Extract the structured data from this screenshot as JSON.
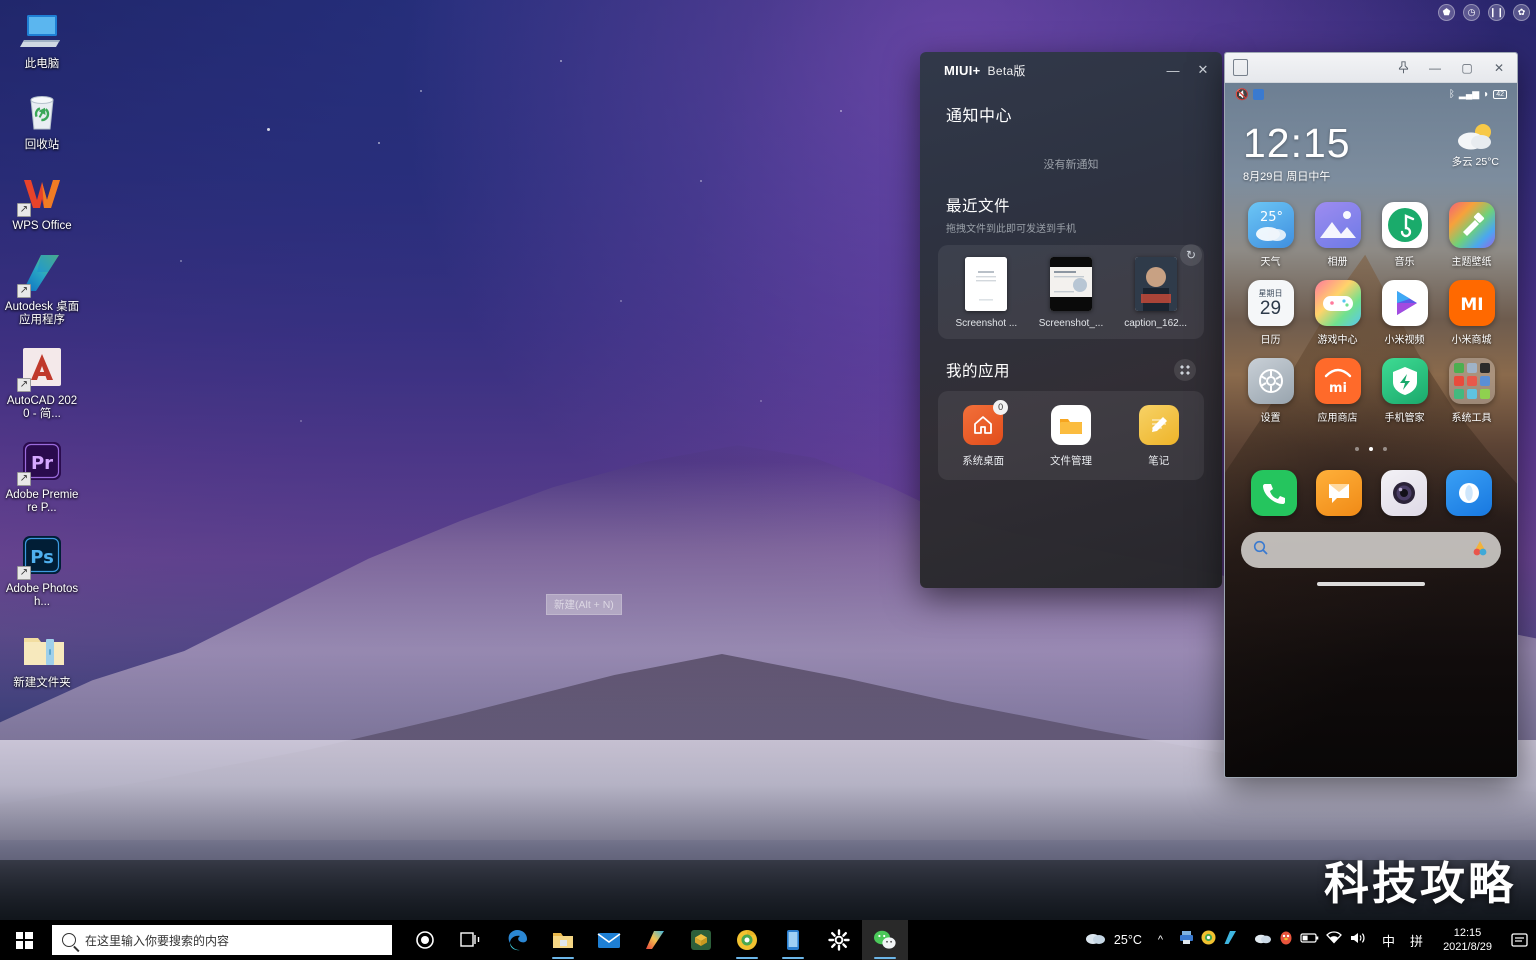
{
  "desktop": {
    "icons": [
      {
        "label": "此电脑",
        "icon": "computer-icon",
        "shortcut": false
      },
      {
        "label": "回收站",
        "icon": "recycle-bin-icon",
        "shortcut": false
      },
      {
        "label": "WPS Office",
        "icon": "wps-office-icon",
        "shortcut": true
      },
      {
        "label": "Autodesk 桌面应用程序",
        "icon": "autodesk-icon",
        "shortcut": true
      },
      {
        "label": "AutoCAD 2020 - 简...",
        "icon": "autocad-icon",
        "shortcut": true
      },
      {
        "label": "Adobe Premiere P...",
        "icon": "premiere-pro-icon",
        "shortcut": true
      },
      {
        "label": "Adobe Photosh...",
        "icon": "photoshop-icon",
        "shortcut": true
      },
      {
        "label": "新建文件夹",
        "icon": "folder-icon",
        "shortcut": false
      }
    ],
    "tooltip": "新建(Alt + N)",
    "watermark": "科技攻略",
    "floaters": [
      "record-icon",
      "clock-icon",
      "pause-icon",
      "settings-icon"
    ]
  },
  "miui": {
    "brand": "MIUI+",
    "beta": "Beta版",
    "minimize_label": "—",
    "close_label": "✕",
    "notification": {
      "title": "通知中心",
      "empty_text": "没有新通知"
    },
    "recent_files": {
      "title": "最近文件",
      "subtitle": "拖拽文件到此即可发送到手机",
      "refresh_icon": "refresh-icon",
      "items": [
        {
          "name": "Screenshot ...",
          "thumb": "document-thumb"
        },
        {
          "name": "Screenshot_...",
          "thumb": "article-thumb"
        },
        {
          "name": "caption_162...",
          "thumb": "portrait-thumb"
        }
      ]
    },
    "my_apps": {
      "title": "我的应用",
      "grid_icon": "grid-icon",
      "items": [
        {
          "name": "系统桌面",
          "icon": "home-icon",
          "badge": "0",
          "color": "#ef5a2a"
        },
        {
          "name": "文件管理",
          "icon": "folder-icon",
          "badge": "",
          "color": "#f5a623"
        },
        {
          "name": "笔记",
          "icon": "note-pencil-icon",
          "badge": "",
          "color": "#f3c34a"
        }
      ]
    }
  },
  "phone": {
    "titlebar": {
      "doc_icon": "new-page-icon",
      "pin_label": "pin-icon",
      "minimize_label": "—",
      "maximize_label": "▢",
      "close_label": "✕"
    },
    "statusbar": {
      "left_icons": [
        "mute-icon",
        "app-icon"
      ],
      "right_icons": [
        "bluetooth-icon",
        "signal-icon",
        "wifi-icon"
      ],
      "battery": "42"
    },
    "clock": "12:15",
    "date": "8月29日 周日中午",
    "weather": {
      "condition": "多云",
      "temp": "25°C",
      "icon": "partly-cloudy-icon"
    },
    "apps": [
      {
        "name": "天气",
        "icon": "weather-widget-icon",
        "value": "25°"
      },
      {
        "name": "相册",
        "icon": "gallery-icon",
        "value": ""
      },
      {
        "name": "音乐",
        "icon": "music-icon",
        "value": ""
      },
      {
        "name": "主题壁纸",
        "icon": "themes-icon",
        "value": ""
      },
      {
        "name": "日历",
        "icon": "calendar-icon",
        "value": "29"
      },
      {
        "name": "游戏中心",
        "icon": "game-center-icon",
        "value": ""
      },
      {
        "name": "小米视频",
        "icon": "mi-video-icon",
        "value": ""
      },
      {
        "name": "小米商城",
        "icon": "mi-store-icon",
        "value": ""
      },
      {
        "name": "设置",
        "icon": "settings-gear-icon",
        "value": ""
      },
      {
        "name": "应用商店",
        "icon": "app-store-icon",
        "value": ""
      },
      {
        "name": "手机管家",
        "icon": "security-shield-icon",
        "value": ""
      },
      {
        "name": "系统工具",
        "icon": "system-tools-folder-icon",
        "value": ""
      }
    ],
    "calendar_weekday": "星期日",
    "dock": [
      {
        "name": "电话",
        "icon": "phone-icon"
      },
      {
        "name": "短信",
        "icon": "message-icon"
      },
      {
        "name": "相机",
        "icon": "camera-icon"
      },
      {
        "name": "浏览器",
        "icon": "browser-icon"
      }
    ],
    "search_placeholder": "",
    "search_icon": "search-icon",
    "assistant_icon": "assistant-icon",
    "navbar": {
      "menu": "☰",
      "home": "▢",
      "back": "‹"
    },
    "page_dots": 3,
    "active_dot": 1
  },
  "taskbar": {
    "start_label": "windows-start-icon",
    "search_placeholder": "在这里输入你要搜索的内容",
    "search_icon": "search-icon",
    "pinned": [
      {
        "name": "cortana-icon",
        "running": false,
        "active": false
      },
      {
        "name": "task-view-icon",
        "running": false,
        "active": false
      },
      {
        "name": "edge-icon",
        "running": false,
        "active": false
      },
      {
        "name": "file-explorer-icon",
        "running": true,
        "active": false
      },
      {
        "name": "mail-icon",
        "running": false,
        "active": false
      },
      {
        "name": "autodesk-icon",
        "running": false,
        "active": false
      },
      {
        "name": "3d-viewer-icon",
        "running": false,
        "active": false
      },
      {
        "name": "browser-icon",
        "running": true,
        "active": false
      },
      {
        "name": "phone-link-icon",
        "running": true,
        "active": false
      },
      {
        "name": "settings-icon",
        "running": false,
        "active": false
      },
      {
        "name": "wechat-icon",
        "running": true,
        "active": true
      }
    ],
    "tray": {
      "weather_temp": "25°C",
      "weather_icon": "cloud-icon",
      "chevron": "^",
      "hidden_icons": [
        "printer-icon",
        "chrome-icon",
        "autodesk-icon"
      ],
      "visible_icons": [
        "cloud-icon",
        "qq-penguin-icon",
        "battery-icon",
        "network-icon",
        "volume-icon"
      ],
      "ime_mode": "中",
      "ime_pinyin": "拼",
      "time": "12:15",
      "date": "2021/8/29",
      "action_center": "notification-icon"
    }
  }
}
